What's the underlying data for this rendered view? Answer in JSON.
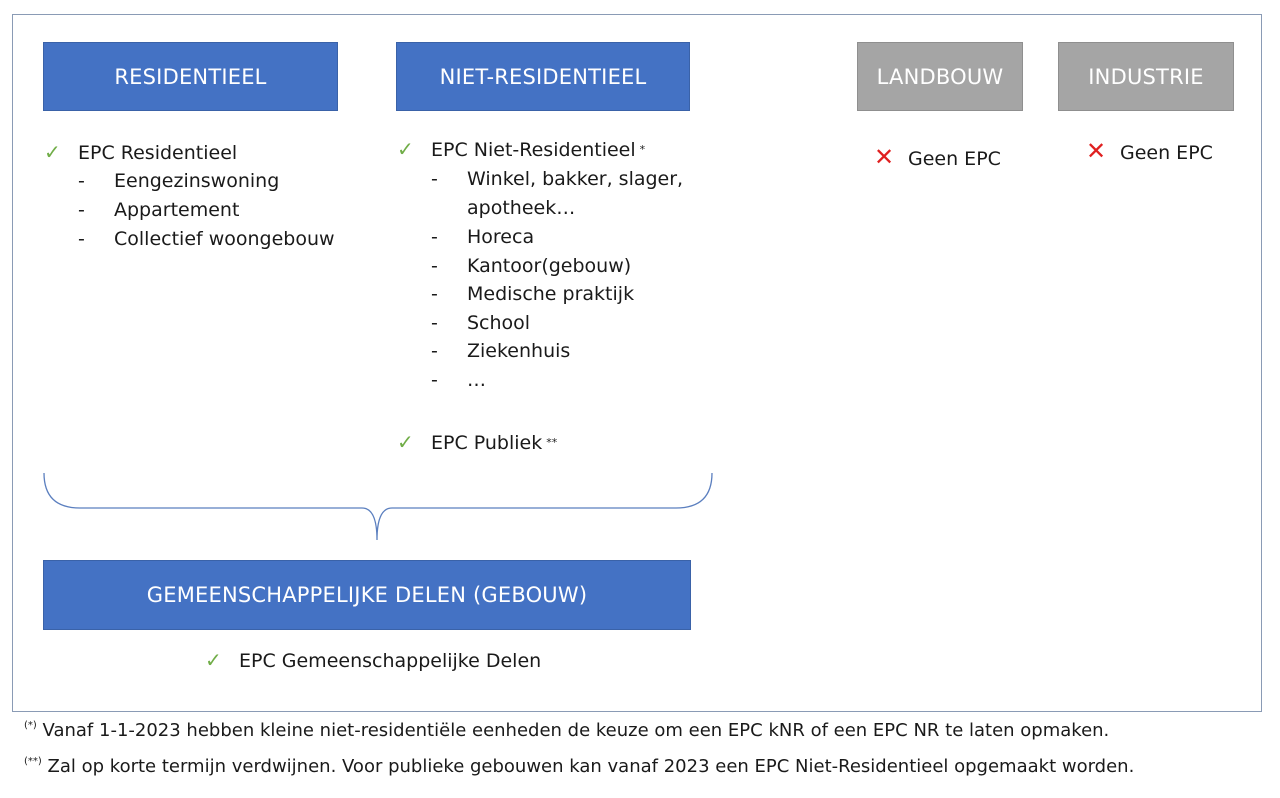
{
  "colors": {
    "blue": "#4472c4",
    "gray": "#a5a5a5",
    "check": "#70ad47",
    "cross": "#e02020"
  },
  "residentieel": {
    "title": "RESIDENTIEEL",
    "epc": "EPC Residentieel",
    "items": [
      "Eengezinswoning",
      "Appartement",
      "Collectief woongebouw"
    ]
  },
  "niet_residentieel": {
    "title": "NIET-RESIDENTIEEL",
    "epc": "EPC Niet-Residentieel",
    "epc_mark": "*",
    "items": [
      "Winkel, bakker, slager,",
      "apotheek…",
      "Horeca",
      "Kantoor(gebouw)",
      "Medische praktijk",
      "School",
      "Ziekenhuis",
      "…"
    ],
    "epc2": "EPC Publiek",
    "epc2_mark": "**"
  },
  "landbouw": {
    "title": "LANDBOUW",
    "epc": "Geen EPC"
  },
  "industrie": {
    "title": "INDUSTRIE",
    "epc": "Geen EPC"
  },
  "gemeenschappelijk": {
    "title": "GEMEENSCHAPPELIJKE DELEN (GEBOUW)",
    "epc": "EPC Gemeenschappelijke Delen"
  },
  "footnotes": [
    {
      "mark": "(*)",
      "text": "Vanaf 1-1-2023 hebben kleine niet-residentiële eenheden de keuze om een EPC kNR of een EPC NR te laten opmaken."
    },
    {
      "mark": "(**)",
      "text": "Zal op korte termijn verdwijnen. Voor publieke gebouwen kan vanaf 2023 een EPC Niet-Residentieel opgemaakt worden."
    }
  ]
}
